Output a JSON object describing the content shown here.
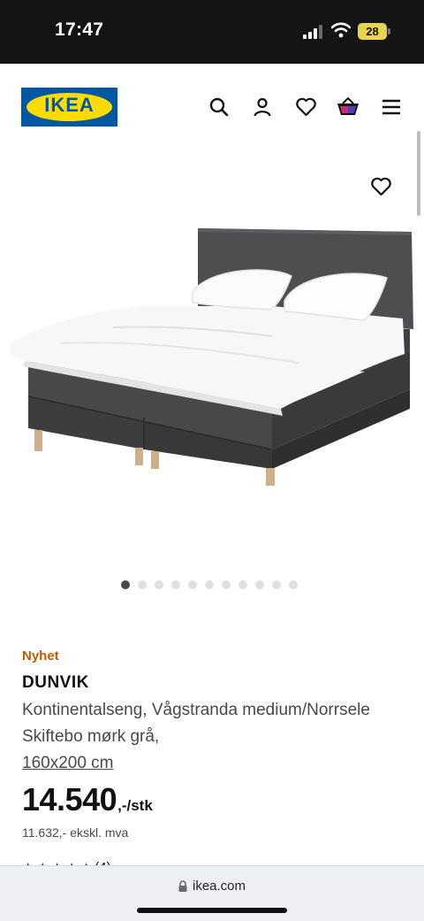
{
  "status": {
    "time": "17:47",
    "battery": "28"
  },
  "header": {
    "logo_text": "IKEA",
    "icons": [
      "search-icon",
      "account-icon",
      "wishlist-heart-icon",
      "shopping-bag-icon",
      "menu-icon"
    ]
  },
  "colors": {
    "brand_blue": "#0058a3",
    "brand_yellow": "#ffdb00",
    "new_badge": "#c45a00"
  },
  "gallery": {
    "total_images": 11,
    "active_index": 0
  },
  "product": {
    "badge": "Nyhet",
    "name": "DUNVIK",
    "description": "Kontinentalseng, Vågstranda medium/Norrsele Skiftebo mørk grå,",
    "size": "160x200 cm",
    "price": "14.540",
    "price_suffix": ",-/stk",
    "price_ex_vat": "11.632,- ekskl. mva",
    "review_count": "(4)"
  },
  "browser": {
    "url": "ikea.com"
  }
}
